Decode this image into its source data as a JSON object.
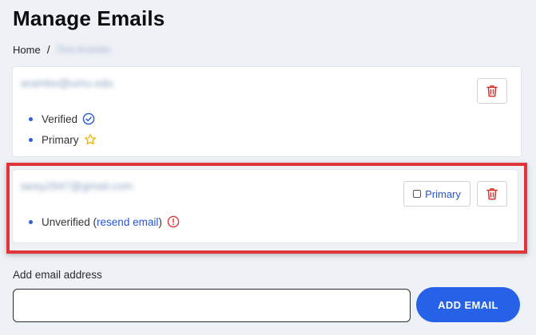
{
  "header": {
    "title": "Manage Emails"
  },
  "breadcrumb": {
    "home": "Home",
    "separator": "/",
    "current": "Tina Arambo"
  },
  "emails": [
    {
      "address": "arambo@umu.edu",
      "statuses": [
        {
          "label": "Verified",
          "icon": "check-circle-icon",
          "color": "#2456d6"
        },
        {
          "label": "Primary",
          "icon": "star-icon",
          "color": "#f0b400"
        }
      ],
      "actions": {
        "delete_icon": "trash-icon"
      }
    },
    {
      "address": "tarey2947@gmail.com",
      "statuses": [
        {
          "label": "Unverified",
          "open_paren": "(",
          "link_text": "resend email",
          "close_paren": ")",
          "icon": "alert-circle-icon",
          "color": "#e0363b"
        }
      ],
      "actions": {
        "make_primary_label": "Primary",
        "delete_icon": "trash-icon"
      }
    }
  ],
  "add_email": {
    "label": "Add email address",
    "input_value": "",
    "button_label": "ADD EMAIL"
  },
  "colors": {
    "accent": "#2562e8",
    "highlight": "#e0363b",
    "danger": "#d0342c"
  }
}
